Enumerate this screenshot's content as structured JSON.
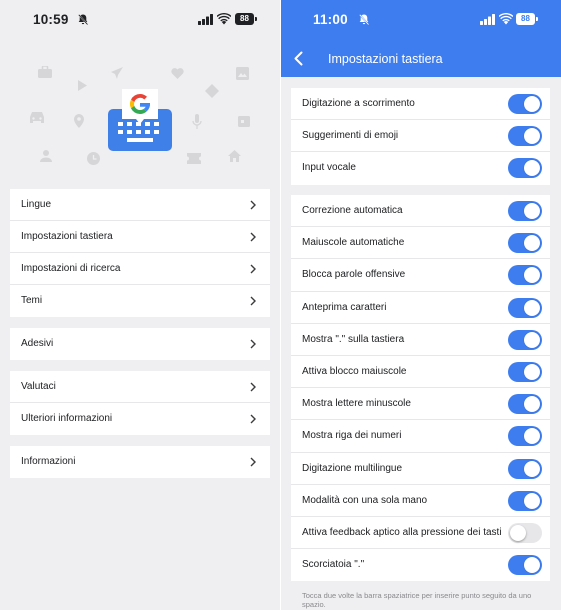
{
  "left": {
    "status": {
      "time": "10:59",
      "battery": "88"
    },
    "colors": {
      "google_blue": "#4285F4",
      "google_red": "#EA4335",
      "google_yellow": "#FBBC05",
      "google_green": "#34A853",
      "keyboard_blue": "#3f80e8"
    },
    "menu_groups": [
      [
        "Lingue",
        "Impostazioni tastiera",
        "Impostazioni di ricerca",
        "Temi"
      ],
      [
        "Adesivi"
      ],
      [
        "Valutaci",
        "Ulteriori informazioni"
      ],
      [
        "Informazioni"
      ]
    ]
  },
  "right": {
    "status": {
      "time": "11:00",
      "battery": "88"
    },
    "appbar": {
      "title": "Impostazioni tastiera",
      "color": "#3d7df0"
    },
    "group1": [
      {
        "label": "Digitazione a scorrimento",
        "on": true
      },
      {
        "label": "Suggerimenti di emoji",
        "on": true
      },
      {
        "label": "Input vocale",
        "on": true
      }
    ],
    "group2": [
      {
        "label": "Correzione automatica",
        "on": true
      },
      {
        "label": "Maiuscole automatiche",
        "on": true
      },
      {
        "label": "Blocca parole offensive",
        "on": true
      },
      {
        "label": "Anteprima caratteri",
        "on": true
      },
      {
        "label": "Mostra \".\" sulla tastiera",
        "on": true
      },
      {
        "label": "Attiva blocco maiuscole",
        "on": true
      },
      {
        "label": "Mostra lettere minuscole",
        "on": true
      },
      {
        "label": "Mostra riga dei numeri",
        "on": true
      },
      {
        "label": "Digitazione multilingue",
        "on": true
      },
      {
        "label": "Modalità con una sola mano",
        "on": true
      },
      {
        "label": "Attiva feedback aptico alla pressione dei tasti",
        "on": false
      },
      {
        "label": "Scorciatoia \".\"",
        "on": true
      }
    ],
    "footnote": "Tocca due volte la barra spaziatrice per inserire punto seguito da uno spazio."
  }
}
